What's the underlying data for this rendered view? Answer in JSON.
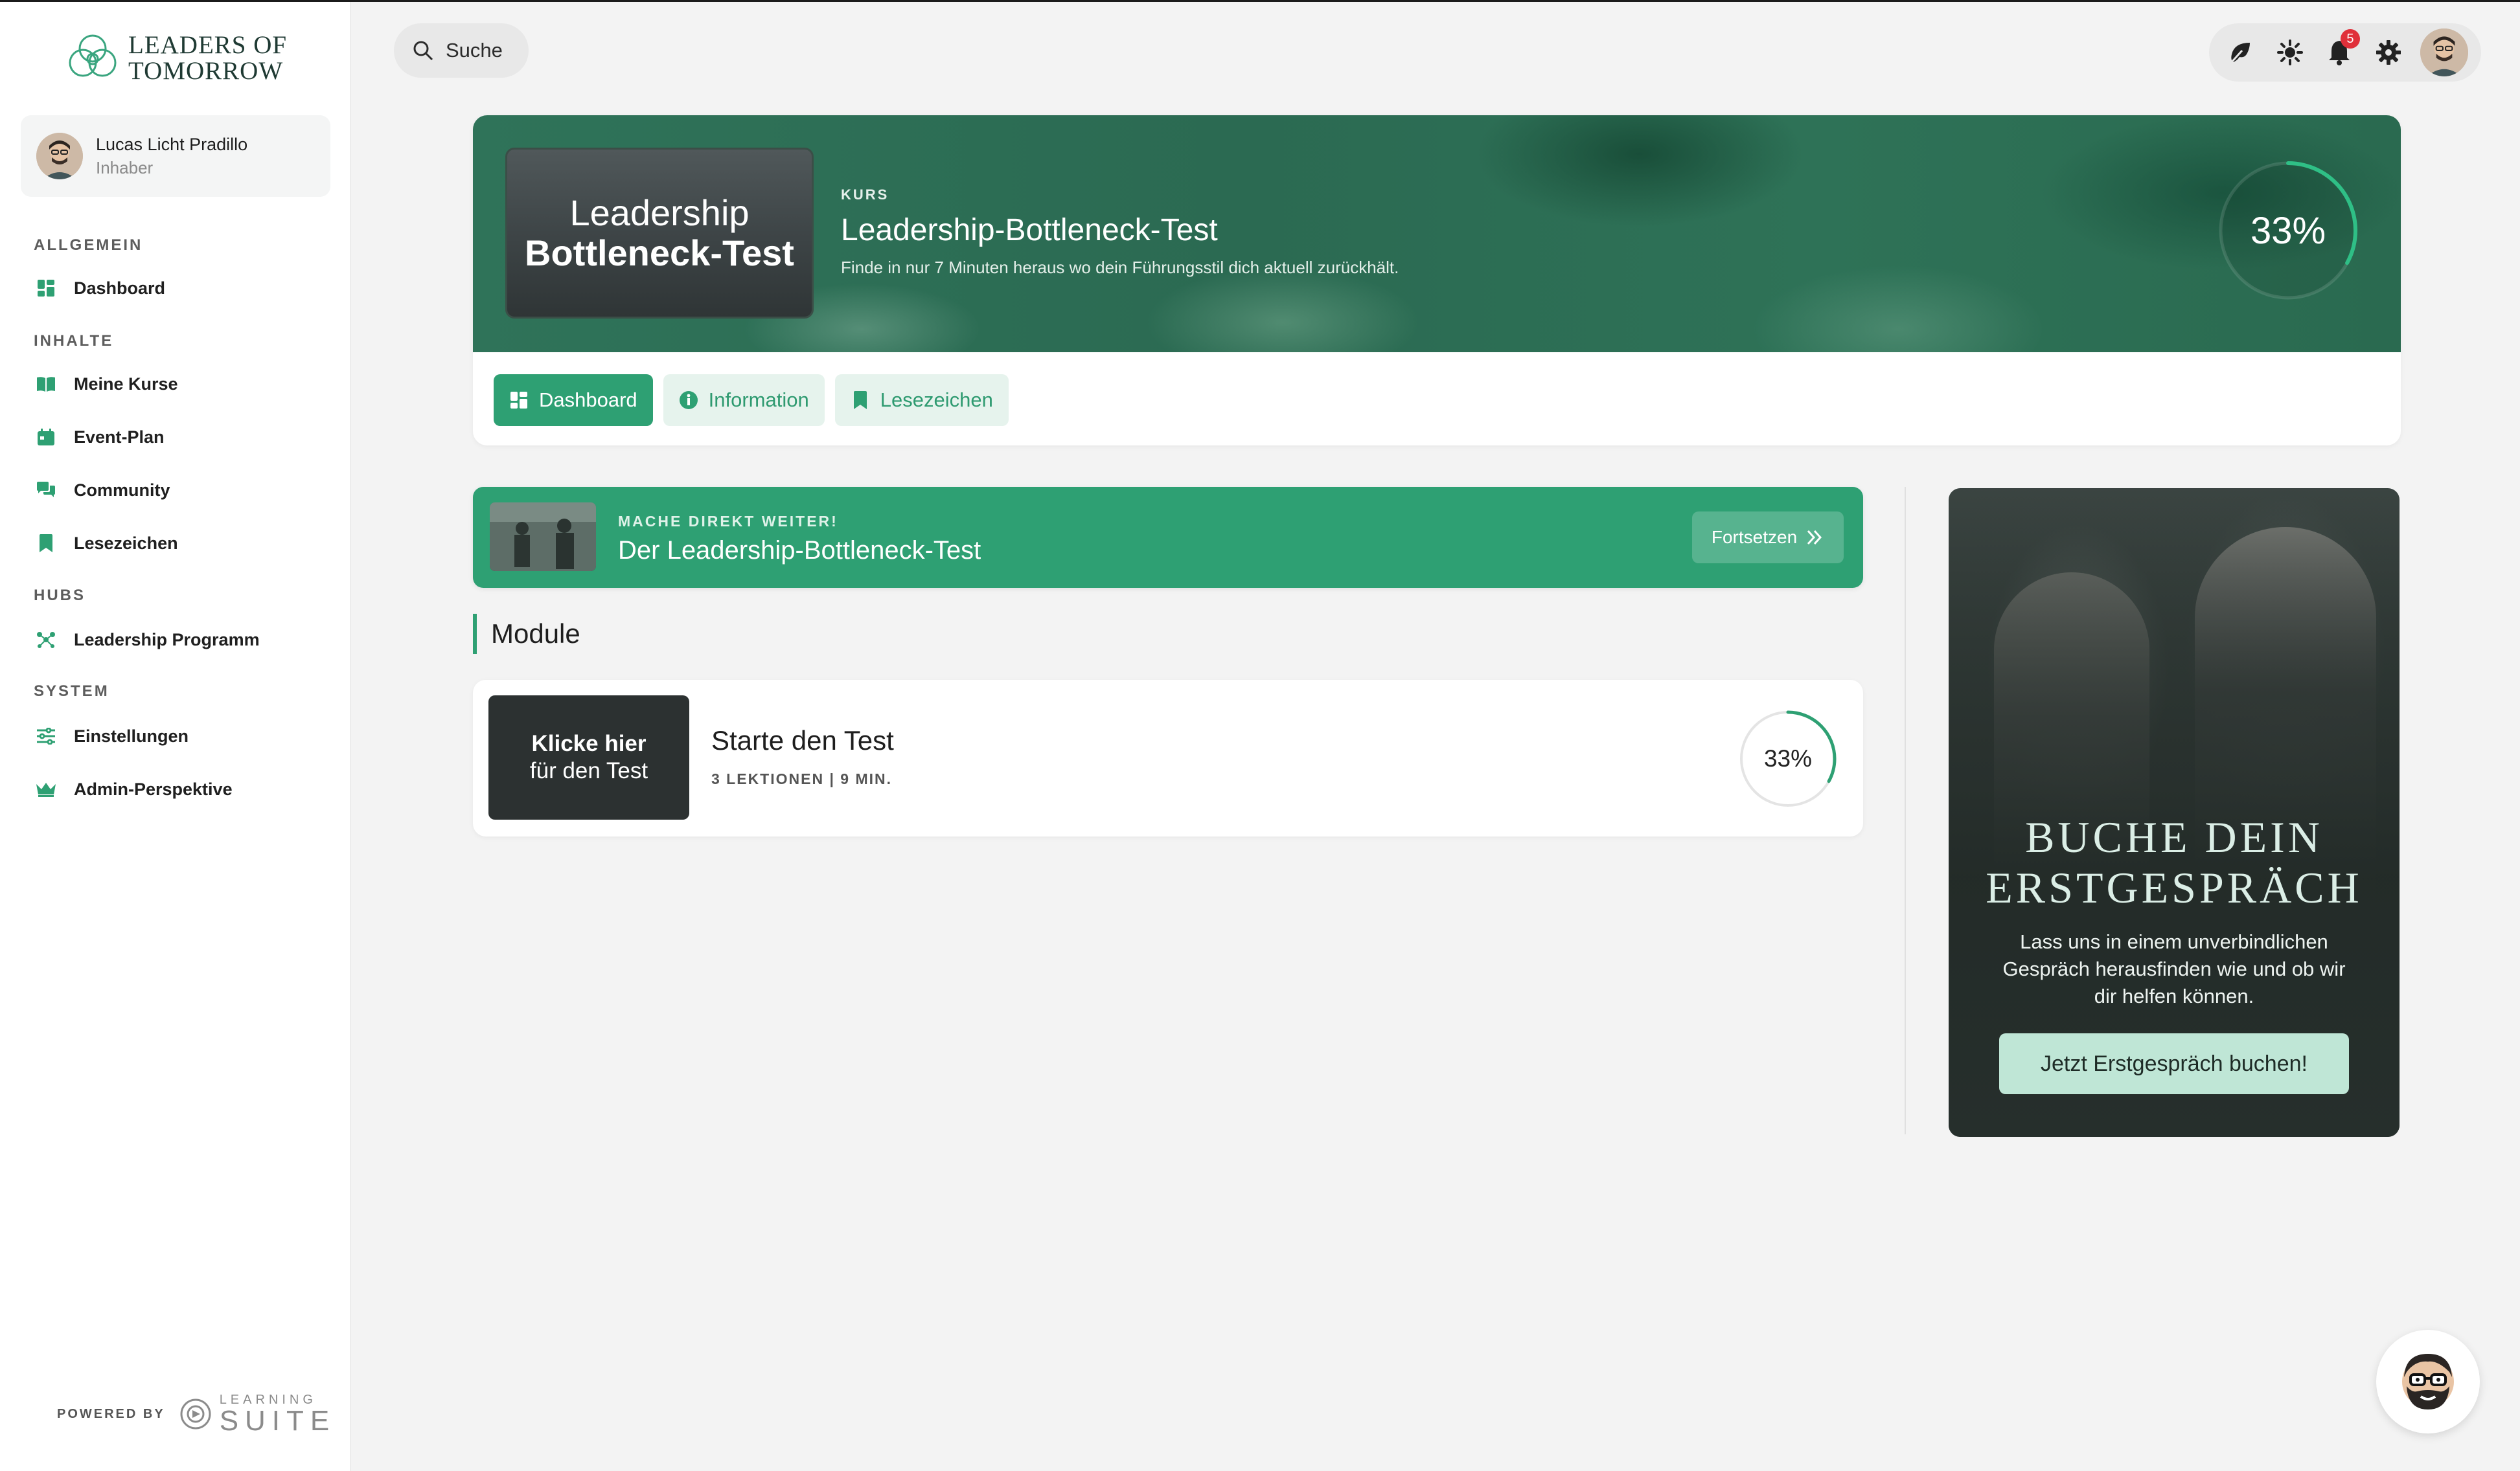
{
  "brand": {
    "name_line1": "LEADERS OF",
    "name_line2": "TOMORROW"
  },
  "user": {
    "name": "Lucas Licht Pradillo",
    "role": "Inhaber"
  },
  "sidebar": {
    "sections": [
      {
        "title": "ALLGEMEIN",
        "items": [
          {
            "label": "Dashboard",
            "icon": "dashboard-icon"
          }
        ]
      },
      {
        "title": "INHALTE",
        "items": [
          {
            "label": "Meine Kurse",
            "icon": "book-icon"
          },
          {
            "label": "Event-Plan",
            "icon": "calendar-icon"
          },
          {
            "label": "Community",
            "icon": "chat-icon"
          },
          {
            "label": "Lesezeichen",
            "icon": "bookmark-icon"
          }
        ]
      },
      {
        "title": "HUBS",
        "items": [
          {
            "label": "Leadership Programm",
            "icon": "network-icon"
          }
        ]
      },
      {
        "title": "SYSTEM",
        "items": [
          {
            "label": "Einstellungen",
            "icon": "sliders-icon"
          },
          {
            "label": "Admin-Perspektive",
            "icon": "crown-icon"
          }
        ]
      }
    ],
    "powered_by": "POWERED BY",
    "powered_brand_small": "LEARNING",
    "powered_brand_big": "SUITE"
  },
  "topbar": {
    "search_label": "Suche",
    "notification_count": "5",
    "icons": [
      "leaf-icon",
      "sun-icon",
      "bell-icon",
      "gear-icon",
      "avatar"
    ]
  },
  "course": {
    "thumb_line1": "Leadership",
    "thumb_line2": "Bottleneck-Test",
    "kicker": "KURS",
    "title": "Leadership-Bottleneck-Test",
    "description": "Finde in nur 7 Minuten heraus wo dein Führungsstil dich aktuell zurückhält.",
    "progress_label": "33%",
    "progress": 0.33,
    "tabs": [
      {
        "label": "Dashboard",
        "icon": "dashboard-icon",
        "active": true
      },
      {
        "label": "Information",
        "icon": "info-icon",
        "active": false
      },
      {
        "label": "Lesezeichen",
        "icon": "bookmark-icon",
        "active": false
      }
    ]
  },
  "continue": {
    "kicker": "MACHE DIREKT WEITER!",
    "title": "Der Leadership-Bottleneck-Test",
    "button": "Fortsetzen"
  },
  "modules": {
    "heading": "Module",
    "items": [
      {
        "thumb_line1": "Klicke hier",
        "thumb_line2": "für den Test",
        "title": "Starte den Test",
        "meta": "3 LEKTIONEN | 9 MIN.",
        "progress_label": "33%",
        "progress": 0.33
      }
    ]
  },
  "ad": {
    "title_line1": "BUCHE DEIN",
    "title_line2": "ERSTGESPRÄCH",
    "text": "Lass uns in einem unverbindlichen Gespräch herausfinden wie und ob wir dir helfen können.",
    "button": "Jetzt Erstgespräch buchen!"
  },
  "colors": {
    "accent": "#2ea073",
    "hero_dark": "#2b6a52",
    "badge": "#e0303a"
  }
}
